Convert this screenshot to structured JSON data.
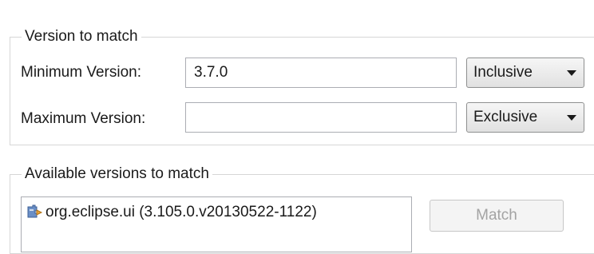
{
  "version_group": {
    "title": "Version to match",
    "minimum": {
      "label": "Minimum Version:",
      "value": "3.7.0",
      "bound": "Inclusive"
    },
    "maximum": {
      "label": "Maximum Version:",
      "value": "",
      "bound": "Exclusive"
    }
  },
  "available_group": {
    "title": "Available versions to match",
    "items": [
      {
        "label": "org.eclipse.ui (3.105.0.v20130522-1122)",
        "icon": "plugin-icon"
      }
    ],
    "match_label": "Match"
  }
}
